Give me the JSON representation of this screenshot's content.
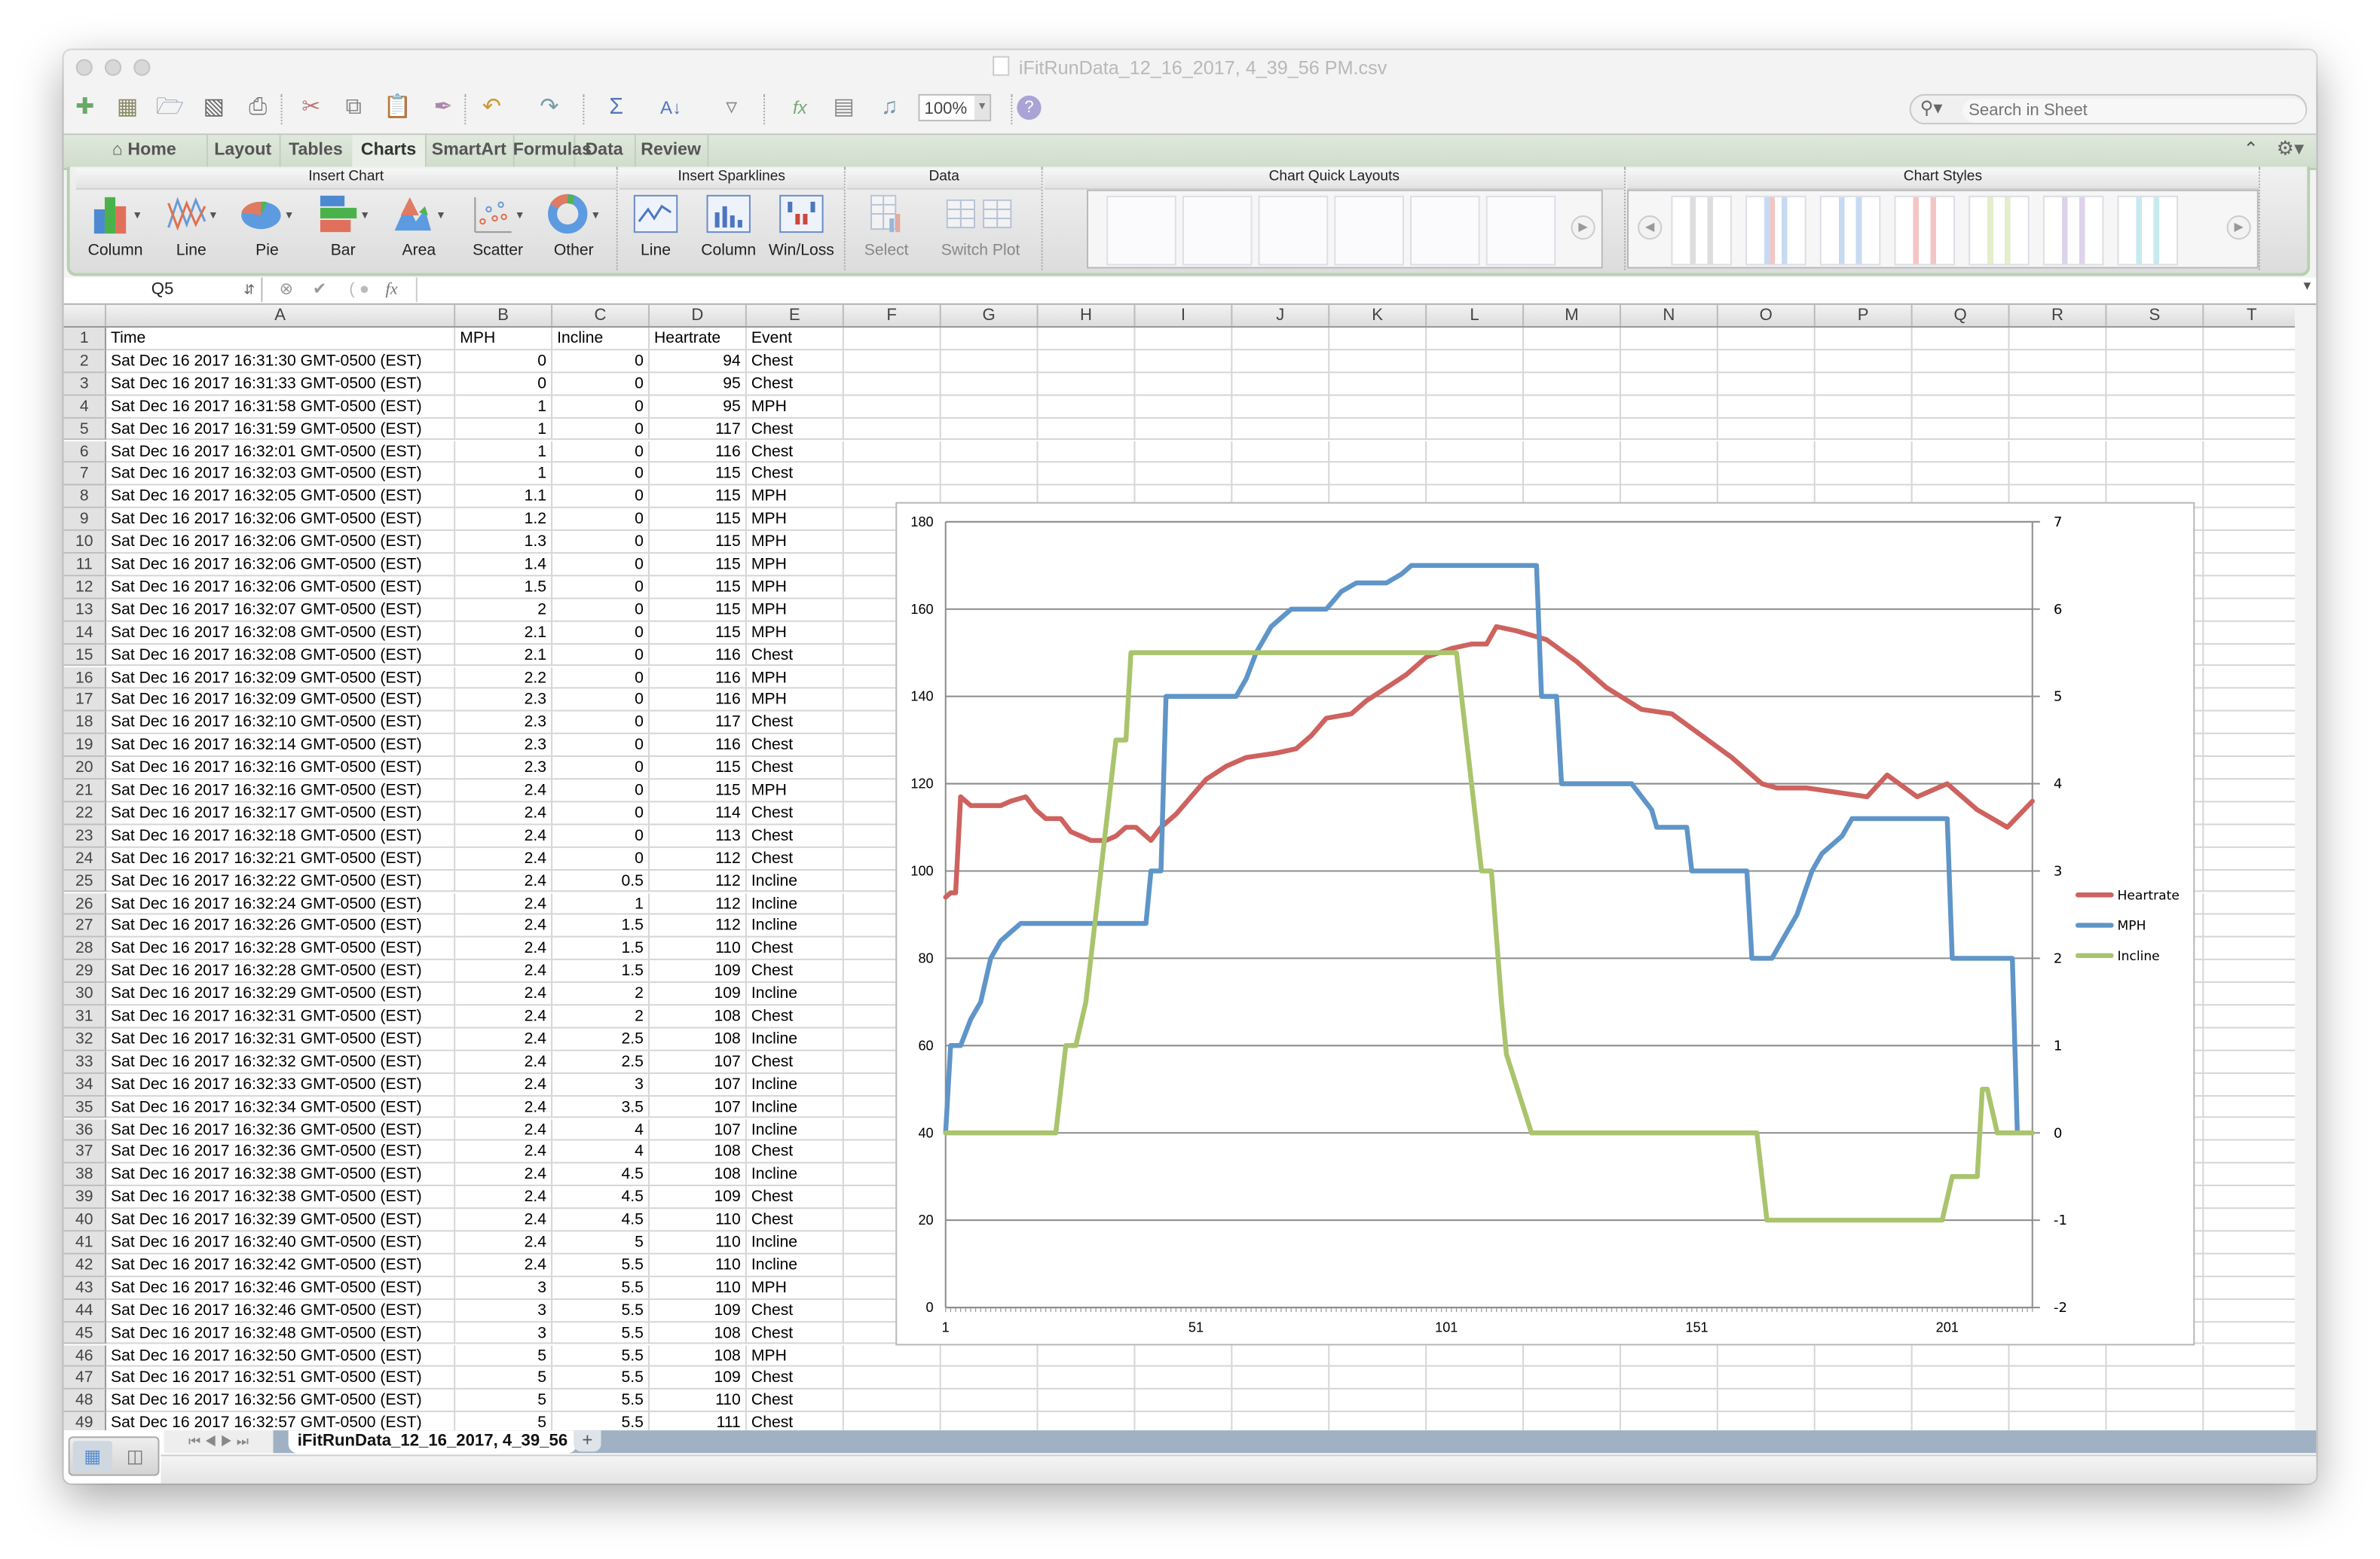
{
  "window": {
    "title": "iFitRunData_12_16_2017, 4_39_56 PM.csv"
  },
  "toolbar": {
    "icons": [
      "new-icon",
      "templates-icon",
      "open-icon",
      "save-icon",
      "print-icon",
      "cut-icon",
      "copy-icon",
      "paste-icon",
      "format-painter-icon",
      "undo-icon",
      "redo-icon",
      "autosum-icon",
      "sort-icon",
      "filter-icon",
      "function-icon",
      "gallery-icon",
      "media-icon",
      "help-icon"
    ],
    "zoom_value": "100%",
    "search_placeholder": "Search in Sheet"
  },
  "ribbon_tabs": [
    {
      "label": "Home",
      "active": false
    },
    {
      "label": "Layout",
      "active": false
    },
    {
      "label": "Tables",
      "active": false
    },
    {
      "label": "Charts",
      "active": true
    },
    {
      "label": "SmartArt",
      "active": false
    },
    {
      "label": "Formulas",
      "active": false
    },
    {
      "label": "Data",
      "active": false
    },
    {
      "label": "Review",
      "active": false
    }
  ],
  "ribbon": {
    "groups": {
      "insert_chart": "Insert Chart",
      "insert_sparklines": "Insert Sparklines",
      "data": "Data",
      "quick_layouts": "Chart Quick Layouts",
      "chart_styles": "Chart Styles"
    },
    "insert_chart_buttons": [
      "Column",
      "Line",
      "Pie",
      "Bar",
      "Area",
      "Scatter",
      "Other"
    ],
    "sparkline_buttons": [
      "Line",
      "Column",
      "Win/Loss"
    ],
    "data_buttons": [
      "Select",
      "Switch Plot"
    ]
  },
  "formula_bar": {
    "name_box": "Q5",
    "formula": ""
  },
  "columns": [
    "A",
    "B",
    "C",
    "D",
    "E",
    "F",
    "G",
    "H",
    "I",
    "J",
    "K",
    "L",
    "M",
    "N",
    "O",
    "P",
    "Q",
    "R",
    "S",
    "T"
  ],
  "table": {
    "headers": [
      "Time",
      "MPH",
      "Incline",
      "Heartrate",
      "Event"
    ],
    "rows": [
      [
        "Sat Dec 16 2017 16:31:30 GMT-0500 (EST)",
        "0",
        "0",
        "94",
        "Chest"
      ],
      [
        "Sat Dec 16 2017 16:31:33 GMT-0500 (EST)",
        "0",
        "0",
        "95",
        "Chest"
      ],
      [
        "Sat Dec 16 2017 16:31:58 GMT-0500 (EST)",
        "1",
        "0",
        "95",
        "MPH"
      ],
      [
        "Sat Dec 16 2017 16:31:59 GMT-0500 (EST)",
        "1",
        "0",
        "117",
        "Chest"
      ],
      [
        "Sat Dec 16 2017 16:32:01 GMT-0500 (EST)",
        "1",
        "0",
        "116",
        "Chest"
      ],
      [
        "Sat Dec 16 2017 16:32:03 GMT-0500 (EST)",
        "1",
        "0",
        "115",
        "Chest"
      ],
      [
        "Sat Dec 16 2017 16:32:05 GMT-0500 (EST)",
        "1.1",
        "0",
        "115",
        "MPH"
      ],
      [
        "Sat Dec 16 2017 16:32:06 GMT-0500 (EST)",
        "1.2",
        "0",
        "115",
        "MPH"
      ],
      [
        "Sat Dec 16 2017 16:32:06 GMT-0500 (EST)",
        "1.3",
        "0",
        "115",
        "MPH"
      ],
      [
        "Sat Dec 16 2017 16:32:06 GMT-0500 (EST)",
        "1.4",
        "0",
        "115",
        "MPH"
      ],
      [
        "Sat Dec 16 2017 16:32:06 GMT-0500 (EST)",
        "1.5",
        "0",
        "115",
        "MPH"
      ],
      [
        "Sat Dec 16 2017 16:32:07 GMT-0500 (EST)",
        "2",
        "0",
        "115",
        "MPH"
      ],
      [
        "Sat Dec 16 2017 16:32:08 GMT-0500 (EST)",
        "2.1",
        "0",
        "115",
        "MPH"
      ],
      [
        "Sat Dec 16 2017 16:32:08 GMT-0500 (EST)",
        "2.1",
        "0",
        "116",
        "Chest"
      ],
      [
        "Sat Dec 16 2017 16:32:09 GMT-0500 (EST)",
        "2.2",
        "0",
        "116",
        "MPH"
      ],
      [
        "Sat Dec 16 2017 16:32:09 GMT-0500 (EST)",
        "2.3",
        "0",
        "116",
        "MPH"
      ],
      [
        "Sat Dec 16 2017 16:32:10 GMT-0500 (EST)",
        "2.3",
        "0",
        "117",
        "Chest"
      ],
      [
        "Sat Dec 16 2017 16:32:14 GMT-0500 (EST)",
        "2.3",
        "0",
        "116",
        "Chest"
      ],
      [
        "Sat Dec 16 2017 16:32:16 GMT-0500 (EST)",
        "2.3",
        "0",
        "115",
        "Chest"
      ],
      [
        "Sat Dec 16 2017 16:32:16 GMT-0500 (EST)",
        "2.4",
        "0",
        "115",
        "MPH"
      ],
      [
        "Sat Dec 16 2017 16:32:17 GMT-0500 (EST)",
        "2.4",
        "0",
        "114",
        "Chest"
      ],
      [
        "Sat Dec 16 2017 16:32:18 GMT-0500 (EST)",
        "2.4",
        "0",
        "113",
        "Chest"
      ],
      [
        "Sat Dec 16 2017 16:32:21 GMT-0500 (EST)",
        "2.4",
        "0",
        "112",
        "Chest"
      ],
      [
        "Sat Dec 16 2017 16:32:22 GMT-0500 (EST)",
        "2.4",
        "0.5",
        "112",
        "Incline"
      ],
      [
        "Sat Dec 16 2017 16:32:24 GMT-0500 (EST)",
        "2.4",
        "1",
        "112",
        "Incline"
      ],
      [
        "Sat Dec 16 2017 16:32:26 GMT-0500 (EST)",
        "2.4",
        "1.5",
        "112",
        "Incline"
      ],
      [
        "Sat Dec 16 2017 16:32:28 GMT-0500 (EST)",
        "2.4",
        "1.5",
        "110",
        "Chest"
      ],
      [
        "Sat Dec 16 2017 16:32:28 GMT-0500 (EST)",
        "2.4",
        "1.5",
        "109",
        "Chest"
      ],
      [
        "Sat Dec 16 2017 16:32:29 GMT-0500 (EST)",
        "2.4",
        "2",
        "109",
        "Incline"
      ],
      [
        "Sat Dec 16 2017 16:32:31 GMT-0500 (EST)",
        "2.4",
        "2",
        "108",
        "Chest"
      ],
      [
        "Sat Dec 16 2017 16:32:31 GMT-0500 (EST)",
        "2.4",
        "2.5",
        "108",
        "Incline"
      ],
      [
        "Sat Dec 16 2017 16:32:32 GMT-0500 (EST)",
        "2.4",
        "2.5",
        "107",
        "Chest"
      ],
      [
        "Sat Dec 16 2017 16:32:33 GMT-0500 (EST)",
        "2.4",
        "3",
        "107",
        "Incline"
      ],
      [
        "Sat Dec 16 2017 16:32:34 GMT-0500 (EST)",
        "2.4",
        "3.5",
        "107",
        "Incline"
      ],
      [
        "Sat Dec 16 2017 16:32:36 GMT-0500 (EST)",
        "2.4",
        "4",
        "107",
        "Incline"
      ],
      [
        "Sat Dec 16 2017 16:32:36 GMT-0500 (EST)",
        "2.4",
        "4",
        "108",
        "Chest"
      ],
      [
        "Sat Dec 16 2017 16:32:38 GMT-0500 (EST)",
        "2.4",
        "4.5",
        "108",
        "Incline"
      ],
      [
        "Sat Dec 16 2017 16:32:38 GMT-0500 (EST)",
        "2.4",
        "4.5",
        "109",
        "Chest"
      ],
      [
        "Sat Dec 16 2017 16:32:39 GMT-0500 (EST)",
        "2.4",
        "4.5",
        "110",
        "Chest"
      ],
      [
        "Sat Dec 16 2017 16:32:40 GMT-0500 (EST)",
        "2.4",
        "5",
        "110",
        "Incline"
      ],
      [
        "Sat Dec 16 2017 16:32:42 GMT-0500 (EST)",
        "2.4",
        "5.5",
        "110",
        "Incline"
      ],
      [
        "Sat Dec 16 2017 16:32:46 GMT-0500 (EST)",
        "3",
        "5.5",
        "110",
        "MPH"
      ],
      [
        "Sat Dec 16 2017 16:32:46 GMT-0500 (EST)",
        "3",
        "5.5",
        "109",
        "Chest"
      ],
      [
        "Sat Dec 16 2017 16:32:48 GMT-0500 (EST)",
        "3",
        "5.5",
        "108",
        "Chest"
      ],
      [
        "Sat Dec 16 2017 16:32:50 GMT-0500 (EST)",
        "5",
        "5.5",
        "108",
        "MPH"
      ],
      [
        "Sat Dec 16 2017 16:32:51 GMT-0500 (EST)",
        "5",
        "5.5",
        "109",
        "Chest"
      ],
      [
        "Sat Dec 16 2017 16:32:56 GMT-0500 (EST)",
        "5",
        "5.5",
        "110",
        "Chest"
      ],
      [
        "Sat Dec 16 2017 16:32:57 GMT-0500 (EST)",
        "5",
        "5.5",
        "111",
        "Chest"
      ]
    ]
  },
  "chart_data": {
    "type": "line",
    "title": "",
    "xlabel": "",
    "ylabel": "",
    "x_tick_labels": [
      "1",
      "51",
      "101",
      "151",
      "201"
    ],
    "x_range": [
      1,
      218
    ],
    "primary_axis": {
      "ylim": [
        0,
        180
      ],
      "ticks": [
        0,
        20,
        40,
        60,
        80,
        100,
        120,
        140,
        160,
        180
      ]
    },
    "secondary_axis": {
      "ylim": [
        -2,
        7
      ],
      "ticks": [
        -2,
        -1,
        0,
        1,
        2,
        3,
        4,
        5,
        6,
        7
      ]
    },
    "grid": true,
    "legend_position": "right",
    "series": [
      {
        "name": "Heartrate",
        "axis": "primary",
        "color": "#cd625f",
        "points": [
          [
            1,
            94
          ],
          [
            2,
            95
          ],
          [
            3,
            95
          ],
          [
            4,
            117
          ],
          [
            6,
            115
          ],
          [
            12,
            115
          ],
          [
            14,
            116
          ],
          [
            17,
            117
          ],
          [
            19,
            114
          ],
          [
            21,
            112
          ],
          [
            24,
            112
          ],
          [
            26,
            109
          ],
          [
            28,
            108
          ],
          [
            30,
            107
          ],
          [
            33,
            107
          ],
          [
            35,
            108
          ],
          [
            37,
            110
          ],
          [
            39,
            110
          ],
          [
            42,
            107
          ],
          [
            44,
            110
          ],
          [
            47,
            113
          ],
          [
            50,
            117
          ],
          [
            53,
            121
          ],
          [
            57,
            124
          ],
          [
            61,
            126
          ],
          [
            67,
            127
          ],
          [
            71,
            128
          ],
          [
            74,
            131
          ],
          [
            77,
            135
          ],
          [
            82,
            136
          ],
          [
            85,
            139
          ],
          [
            89,
            142
          ],
          [
            93,
            145
          ],
          [
            97,
            149
          ],
          [
            102,
            151
          ],
          [
            106,
            152
          ],
          [
            109,
            152
          ],
          [
            111,
            156
          ],
          [
            115,
            155
          ],
          [
            118,
            154
          ],
          [
            121,
            153
          ],
          [
            127,
            148
          ],
          [
            133,
            142
          ],
          [
            140,
            137
          ],
          [
            146,
            136
          ],
          [
            152,
            131
          ],
          [
            158,
            126
          ],
          [
            164,
            120
          ],
          [
            167,
            119
          ],
          [
            173,
            119
          ],
          [
            179,
            118
          ],
          [
            185,
            117
          ],
          [
            189,
            122
          ],
          [
            195,
            117
          ],
          [
            201,
            120
          ],
          [
            207,
            114
          ],
          [
            213,
            110
          ],
          [
            218,
            116
          ]
        ]
      },
      {
        "name": "MPH",
        "axis": "secondary",
        "color": "#5f95c8",
        "points": [
          [
            1,
            0
          ],
          [
            2,
            1
          ],
          [
            4,
            1
          ],
          [
            6,
            1.3
          ],
          [
            8,
            1.5
          ],
          [
            10,
            2
          ],
          [
            12,
            2.2
          ],
          [
            14,
            2.3
          ],
          [
            16,
            2.4
          ],
          [
            41,
            2.4
          ],
          [
            42,
            3
          ],
          [
            44,
            3
          ],
          [
            45,
            5
          ],
          [
            59,
            5
          ],
          [
            61,
            5.2
          ],
          [
            63,
            5.5
          ],
          [
            66,
            5.8
          ],
          [
            70,
            6
          ],
          [
            77,
            6
          ],
          [
            80,
            6.2
          ],
          [
            83,
            6.3
          ],
          [
            89,
            6.3
          ],
          [
            92,
            6.4
          ],
          [
            94,
            6.5
          ],
          [
            119,
            6.5
          ],
          [
            120,
            5
          ],
          [
            123,
            5
          ],
          [
            124,
            4
          ],
          [
            138,
            4
          ],
          [
            142,
            3.7
          ],
          [
            143,
            3.5
          ],
          [
            149,
            3.5
          ],
          [
            150,
            3
          ],
          [
            161,
            3
          ],
          [
            162,
            2
          ],
          [
            166,
            2
          ],
          [
            171,
            2.5
          ],
          [
            174,
            3
          ],
          [
            176,
            3.2
          ],
          [
            180,
            3.4
          ],
          [
            182,
            3.6
          ],
          [
            201,
            3.6
          ],
          [
            202,
            2
          ],
          [
            214,
            2
          ],
          [
            215,
            0
          ],
          [
            218,
            0
          ]
        ]
      },
      {
        "name": "Incline",
        "axis": "secondary",
        "color": "#a9c46c",
        "points": [
          [
            1,
            0
          ],
          [
            23,
            0
          ],
          [
            25,
            1
          ],
          [
            27,
            1
          ],
          [
            29,
            1.5
          ],
          [
            31,
            2.5
          ],
          [
            32,
            3
          ],
          [
            33,
            3.5
          ],
          [
            34,
            4
          ],
          [
            35,
            4.5
          ],
          [
            37,
            4.5
          ],
          [
            38,
            5.5
          ],
          [
            103,
            5.5
          ],
          [
            108,
            3
          ],
          [
            110,
            3
          ],
          [
            112,
            1.5
          ],
          [
            113,
            0.9
          ],
          [
            118,
            0
          ],
          [
            163,
            0
          ],
          [
            165,
            -1
          ],
          [
            200,
            -1
          ],
          [
            202,
            -0.5
          ],
          [
            207,
            -0.5
          ],
          [
            208,
            0.5
          ],
          [
            209,
            0.5
          ],
          [
            211,
            0
          ],
          [
            218,
            0
          ]
        ]
      }
    ]
  },
  "sheet_tabs": {
    "active": "iFitRunData_12_16_2017, 4_39_56",
    "add_label": "+"
  }
}
